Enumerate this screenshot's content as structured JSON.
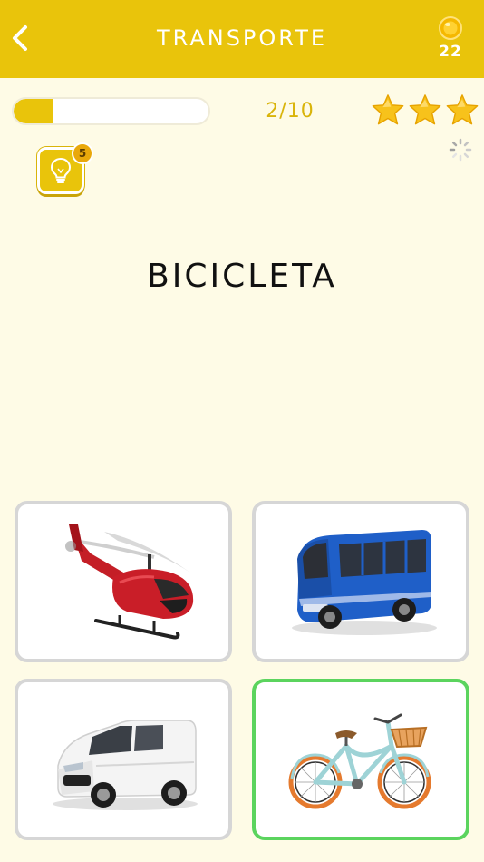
{
  "header": {
    "title": "TRANSPORTE",
    "back_icon": "chevron-left-icon",
    "coin_icon": "coin-icon",
    "coins": "22"
  },
  "progress": {
    "text": "2/10",
    "fraction": 0.2
  },
  "stars": {
    "count": 3,
    "filled": 3
  },
  "hint": {
    "icon": "lightbulb-icon",
    "count": "5"
  },
  "question": {
    "word": "BICICLETA"
  },
  "options": [
    {
      "name": "helicopter",
      "icon": "helicopter-image"
    },
    {
      "name": "bus",
      "icon": "bus-image"
    },
    {
      "name": "van",
      "icon": "van-image"
    },
    {
      "name": "bicycle",
      "icon": "bicycle-image",
      "state": "correct"
    }
  ],
  "colors": {
    "primary": "#E9C40B",
    "background": "#FEFBE6",
    "correct": "#5BD45E",
    "card_border": "#D6D6D6"
  }
}
